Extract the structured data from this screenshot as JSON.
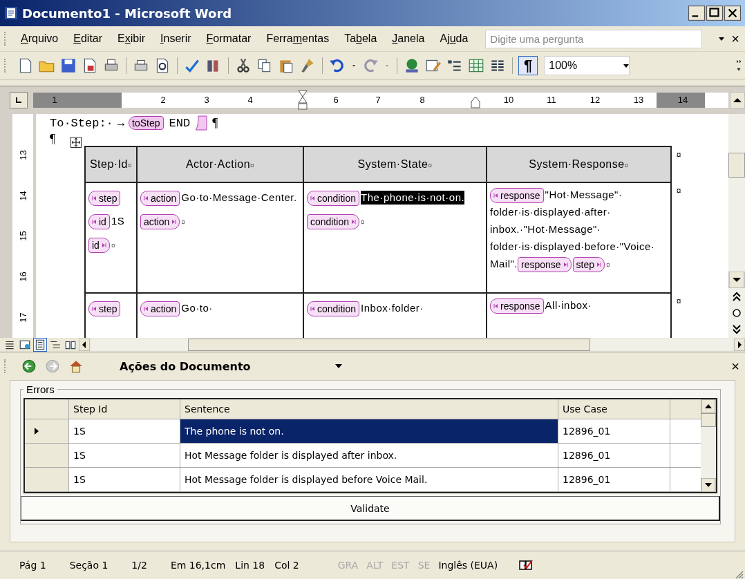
{
  "window": {
    "title": "Documento1 - Microsoft Word"
  },
  "menu": {
    "items": [
      [
        {
          "text": "A",
          "underlined": true
        },
        {
          "text": "rquivo",
          "underlined": false
        }
      ],
      [
        {
          "text": "E",
          "underlined": true
        },
        {
          "text": "ditar",
          "underlined": false
        }
      ],
      [
        {
          "text": "E",
          "underlined": false
        },
        {
          "text": "x",
          "underlined": true
        },
        {
          "text": "ibir",
          "underlined": false
        }
      ],
      [
        {
          "text": "I",
          "underlined": true
        },
        {
          "text": "nserir",
          "underlined": false
        }
      ],
      [
        {
          "text": "F",
          "underlined": true
        },
        {
          "text": "ormatar",
          "underlined": false
        }
      ],
      [
        {
          "text": "Ferra",
          "underlined": false
        },
        {
          "text": "m",
          "underlined": true
        },
        {
          "text": "entas",
          "underlined": false
        }
      ],
      [
        {
          "text": "Ta",
          "underlined": false
        },
        {
          "text": "b",
          "underlined": true
        },
        {
          "text": "ela",
          "underlined": false
        }
      ],
      [
        {
          "text": "J",
          "underlined": true
        },
        {
          "text": "anela",
          "underlined": false
        }
      ],
      [
        {
          "text": "Aj",
          "underlined": false
        },
        {
          "text": "u",
          "underlined": true
        },
        {
          "text": "da",
          "underlined": false
        }
      ]
    ],
    "help_placeholder": "Digite uma pergunta",
    "close": "×"
  },
  "toolbar": {
    "show_marks": {
      "text": "¶",
      "on": true
    },
    "zoom": "100%"
  },
  "ruler": {
    "horizontal": [
      "1",
      "2",
      "3",
      "4",
      "6",
      "7",
      "8",
      "10",
      "11",
      "12",
      "13",
      "14"
    ],
    "vertical": [
      "13",
      "14",
      "15",
      "16",
      "17"
    ]
  },
  "document": {
    "heading": [
      {
        "kind": "text",
        "text": "To·Step:·"
      },
      {
        "kind": "text",
        "text": "→"
      },
      {
        "kind": "open",
        "text": "toStep"
      },
      {
        "kind": "text",
        "text": "END"
      },
      {
        "kind": "close_bare"
      },
      {
        "kind": "mark",
        "text": "¶"
      }
    ],
    "pilcrow": "¶",
    "header": [
      [
        {
          "kind": "text",
          "text": "Step·Id"
        },
        {
          "kind": "mark",
          "text": "¤"
        }
      ],
      [
        {
          "kind": "text",
          "text": "Actor·Action"
        },
        {
          "kind": "mark",
          "text": "¤"
        }
      ],
      [
        {
          "kind": "text",
          "text": "System·State"
        },
        {
          "kind": "mark",
          "text": "¤"
        }
      ],
      [
        {
          "kind": "text",
          "text": "System·Response"
        },
        {
          "kind": "mark",
          "text": "¤"
        }
      ]
    ],
    "header_row_mark": "¤",
    "rows": [
      {
        "row_mark": "¤",
        "cells": [
          [
            {
              "kind": "open",
              "text": "step"
            },
            {
              "kind": "open",
              "text": "id"
            },
            {
              "kind": "text",
              "text": "1",
              "selected": false
            },
            {
              "kind": "text",
              "text": "S",
              "selected": false
            },
            {
              "kind": "close",
              "text": "id"
            },
            {
              "kind": "mark",
              "text": "¤"
            }
          ],
          [
            {
              "kind": "open",
              "text": "action"
            },
            {
              "kind": "text",
              "text": "Go·to·Message·",
              "selected": false
            },
            {
              "kind": "text",
              "text": "Center.",
              "selected": false
            },
            {
              "kind": "close",
              "text": "action"
            },
            {
              "kind": "mark",
              "text": "¤"
            }
          ],
          [
            {
              "kind": "open",
              "text": "condition"
            },
            {
              "kind": "text",
              "text": "The·phone·is·",
              "selected": true
            },
            {
              "kind": "text",
              "text": "not·on.",
              "selected": true
            },
            {
              "kind": "close",
              "text": "condition"
            },
            {
              "kind": "mark",
              "text": "¤"
            }
          ],
          [
            {
              "kind": "open",
              "text": "response"
            },
            {
              "kind": "text",
              "text": "\"Hot·Message\"·",
              "selected": false
            },
            {
              "kind": "text",
              "text": "folder·is·displayed·after·",
              "selected": false
            },
            {
              "kind": "text",
              "text": "inbox.·\"Hot·Message\"·",
              "selected": false
            },
            {
              "kind": "text",
              "text": "folder·is·displayed·before·",
              "selected": false
            },
            {
              "kind": "text",
              "text": "\"Voice·",
              "selected": false
            },
            {
              "kind": "text",
              "text": "Mail\".",
              "selected": false
            },
            {
              "kind": "close",
              "text": "response"
            },
            {
              "kind": "close",
              "text": "step"
            },
            {
              "kind": "mark",
              "text": "¤"
            }
          ]
        ]
      },
      {
        "row_mark": "¤",
        "cells": [
          [
            {
              "kind": "open",
              "text": "step"
            }
          ],
          [
            {
              "kind": "open",
              "text": "action"
            },
            {
              "kind": "text",
              "text": "Go·to·",
              "selected": false
            }
          ],
          [
            {
              "kind": "open",
              "text": "condition"
            },
            {
              "kind": "text",
              "text": "Inbox·folder·",
              "selected": false
            }
          ],
          [
            {
              "kind": "open",
              "text": "response"
            },
            {
              "kind": "text",
              "text": "All·inbox·",
              "selected": false
            }
          ]
        ]
      }
    ]
  },
  "view_buttons": [
    {
      "kind": "normal",
      "selected": false
    },
    {
      "kind": "web",
      "selected": false
    },
    {
      "kind": "print",
      "selected": true
    },
    {
      "kind": "outline",
      "selected": false
    },
    {
      "kind": "reading",
      "selected": false
    }
  ],
  "task_pane": {
    "title": "Ações do Documento",
    "close": "×",
    "forward_enabled": false,
    "group": "Errors",
    "columns": [
      "Step Id",
      "Sentence",
      "Use Case"
    ],
    "rows": [
      {
        "step_id": "1S",
        "sentence": "The phone is not on.",
        "use_case": "12896_01",
        "selected": true
      },
      {
        "step_id": "1S",
        "sentence": "Hot Message folder is displayed after inbox.",
        "use_case": "12896_01",
        "selected": false
      },
      {
        "step_id": "1S",
        "sentence": "Hot Message folder is displayed before Voice Mail.",
        "use_case": "12896_01",
        "selected": false
      }
    ],
    "button": "Validate"
  },
  "status_bar": {
    "fields": [
      "Pág 1",
      "Seção 1",
      "1/2",
      "Em 16,1cm",
      "Lin 18",
      "Col 2"
    ],
    "modes": [
      {
        "text": "GRA",
        "enabled": false
      },
      {
        "text": "ALT",
        "enabled": false
      },
      {
        "text": "EST",
        "enabled": false
      },
      {
        "text": "SE",
        "enabled": false
      }
    ],
    "language": "Inglês (EUA)"
  }
}
